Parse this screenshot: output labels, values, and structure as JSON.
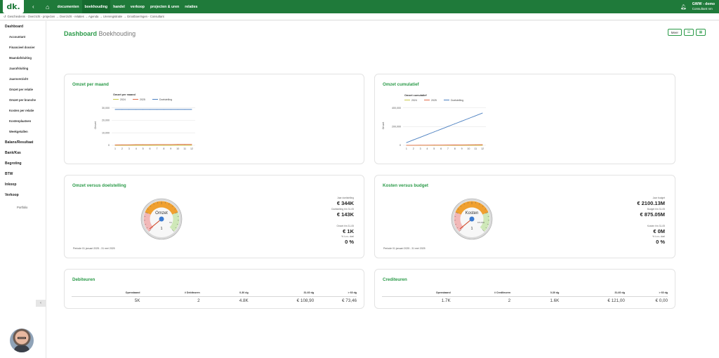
{
  "app": {
    "logo": "dk.",
    "nav": [
      "documenten",
      "boekhouding",
      "handel",
      "verkoop",
      "projecten & uren",
      "relaties"
    ],
    "active_nav": 1,
    "user_name": "GWW - demo",
    "user_role": "Consultant nm"
  },
  "breadcrumb": "Geschiedenis · Overzicht - projecten → Overzicht - relaties → Agenda → Urenregistratie → Grootboeringen - Consultant",
  "sidebar": {
    "groups": [
      {
        "label": "Dashboard",
        "items": [
          "Accountant",
          "Financieel dossier",
          "Maandafsluiting",
          "Jaarafsluiting",
          "Jaaroverzicht",
          "Omzet per relatie",
          "Omzet per branche",
          "Kosten per relatie",
          "Kostenplaatsen",
          "Weekgetallen"
        ]
      },
      {
        "label": "Balans/Resultaat",
        "items": []
      },
      {
        "label": "Bank/Kas",
        "items": []
      },
      {
        "label": "Begroting",
        "items": []
      },
      {
        "label": "BTW",
        "items": []
      },
      {
        "label": "Inkoop",
        "items": []
      },
      {
        "label": "Verkoop",
        "items": []
      }
    ],
    "footer": "Portfolio"
  },
  "page": {
    "title_strong": "Dashboard",
    "title_rest": "Boekhouding",
    "btn_meer": "Meer"
  },
  "omzet_maand": {
    "title": "Omzet per maand",
    "chart_data": {
      "type": "line",
      "title": "Omzet per maand",
      "ylabel": "Omzet",
      "x": [
        "1",
        "2",
        "3",
        "4",
        "5",
        "6",
        "7",
        "8",
        "9",
        "10",
        "11",
        "12"
      ],
      "yticks": [
        "0",
        "10,000",
        "20,000",
        "30,000"
      ],
      "ylim": [
        0,
        32000
      ],
      "legend": "top-left",
      "series": [
        {
          "name": "2024",
          "color": "#c8c84a",
          "values": [
            0,
            0,
            0,
            0,
            0,
            0,
            0,
            0,
            0,
            0,
            0,
            0
          ]
        },
        {
          "name": "2025",
          "color": "#e06b4a",
          "values": [
            300,
            400,
            400,
            500,
            500,
            500,
            600,
            600,
            600,
            700,
            700,
            700
          ]
        },
        {
          "name": "Doelstelling",
          "color": "#4a7fc0",
          "values": [
            28700,
            28700,
            28700,
            28700,
            28700,
            28700,
            28700,
            28700,
            28700,
            28700,
            28700,
            28700
          ]
        }
      ]
    }
  },
  "omzet_cum": {
    "title": "Omzet cumulatief",
    "chart_data": {
      "type": "line",
      "title": "Omzet cumulatief",
      "ylabel": "Omzet",
      "x": [
        "1",
        "2",
        "3",
        "4",
        "5",
        "6",
        "7",
        "8",
        "9",
        "10",
        "11",
        "12"
      ],
      "yticks": [
        "0",
        "200,000",
        "400,000"
      ],
      "ylim": [
        0,
        420000
      ],
      "legend": "top-left",
      "series": [
        {
          "name": "2024",
          "color": "#c8c84a",
          "values": [
            0,
            0,
            0,
            0,
            0,
            0,
            0,
            0,
            0,
            0,
            0,
            0
          ]
        },
        {
          "name": "2025",
          "color": "#e06b4a",
          "values": [
            300,
            700,
            1100,
            1600,
            2100,
            2600,
            3200,
            3800,
            4400,
            5100,
            5800,
            6500
          ]
        },
        {
          "name": "Doelstelling",
          "color": "#4a7fc0",
          "values": [
            28700,
            57400,
            86100,
            114800,
            143500,
            172200,
            200900,
            229600,
            258300,
            287000,
            315700,
            344400
          ]
        }
      ]
    }
  },
  "omzet_doel": {
    "title": "Omzet versus doelstelling",
    "gauge_label": "Omzet",
    "gauge_value": "1",
    "gauge_needle": 0.02,
    "gauge_hint": "5%",
    "kvs": [
      {
        "label": "Jaar doelstelling",
        "value": "€ 344K"
      },
      {
        "label": "Doelstelling t/m 31-05",
        "value": "€ 143K"
      },
      {
        "label": "Omzet t/m 31-05",
        "value": "€ 1K"
      },
      {
        "label": "% t.o.v. doel",
        "value": "0 %"
      }
    ],
    "period": "Periode 01 januari 2025 - 31 mei 2025"
  },
  "kosten_budget": {
    "title": "Kosten versus budget",
    "gauge_label": "Kosten",
    "gauge_value": "1",
    "gauge_needle": 0.02,
    "gauge_hint": "875.05M",
    "kvs": [
      {
        "label": "Jaar budget",
        "value": "€ 2100.13M"
      },
      {
        "label": "Budget t/m 31-05",
        "value": "€ 875.05M"
      },
      {
        "label": "Kosten t/m 31-05",
        "value": "€ 0M"
      },
      {
        "label": "% t.o.v. doel",
        "value": "0 %"
      }
    ],
    "period": "Periode 01 januari 2025 - 31 mei 2025"
  },
  "debiteuren": {
    "title": "Debiteuren",
    "headers": [
      "Openstaand",
      "# Debiteuren",
      "0-30 dg",
      "31-60 dg",
      "> 60 dg"
    ],
    "values": [
      "5K",
      "2",
      "4.8K",
      "€ 108,90",
      "€ 73,46"
    ]
  },
  "crediteuren": {
    "title": "Crediteuren",
    "headers": [
      "Openstaand",
      "# Crediteuren",
      "0-30 dg",
      "31-60 dg",
      "> 60 dg"
    ],
    "values": [
      "1.7K",
      "2",
      "1.6K",
      "€ 121,00",
      "€ 0,00"
    ]
  },
  "colors": {
    "brand": "#1f7a3a",
    "accent": "#2a9a48"
  },
  "icons": [
    "home-icon",
    "bell-icon",
    "chevron-left-icon",
    "filter-icon",
    "calendar-icon",
    "history-icon"
  ]
}
